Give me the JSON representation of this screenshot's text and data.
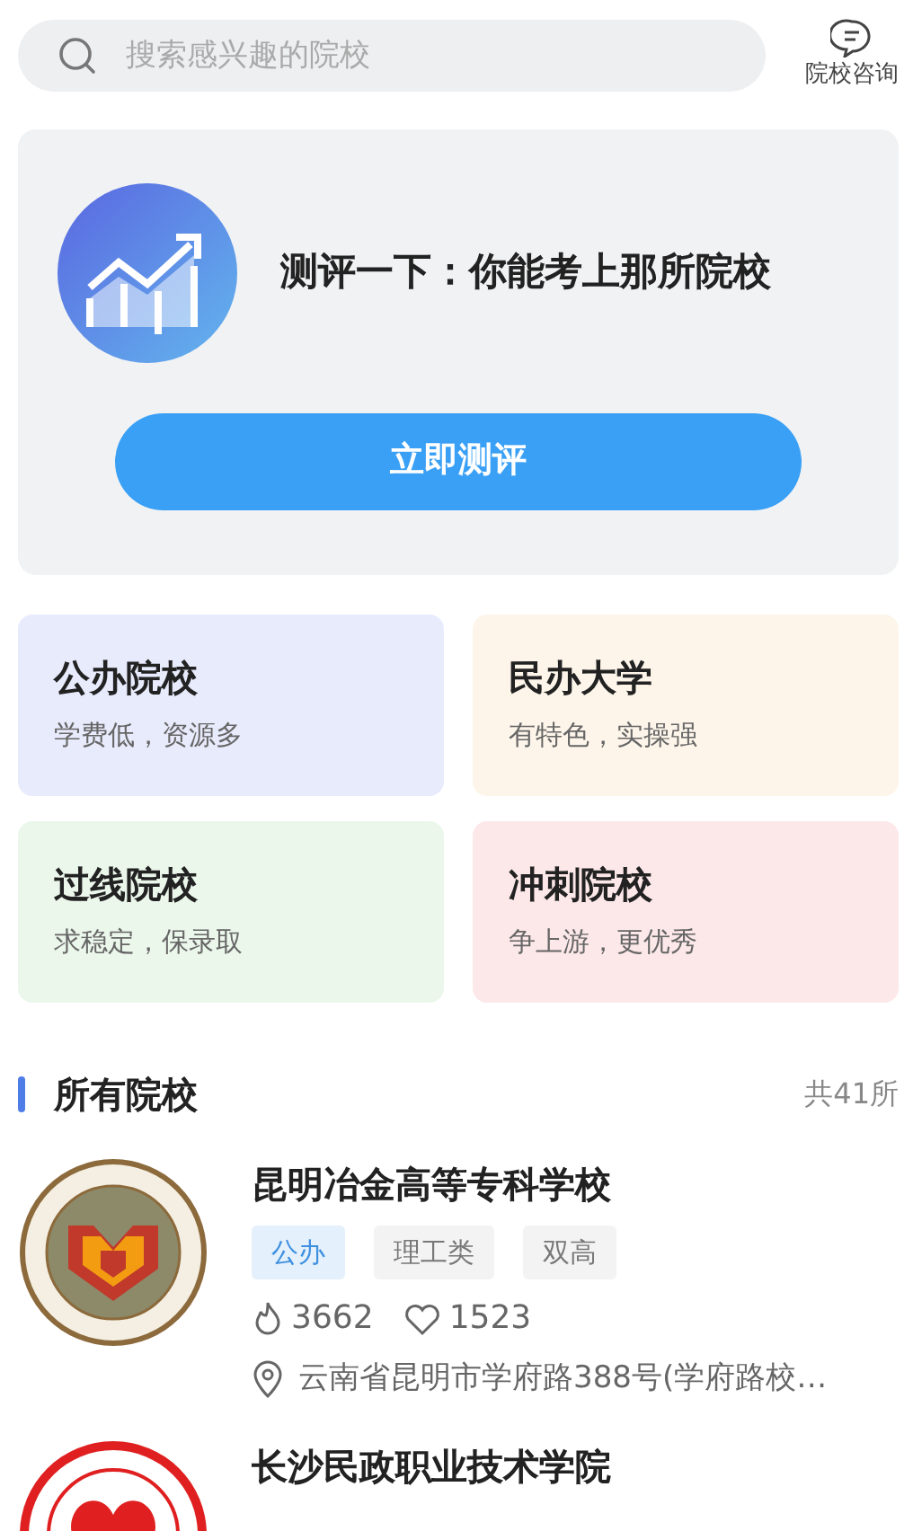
{
  "search": {
    "placeholder": "搜索感兴趣的院校"
  },
  "consult": {
    "label": "院校咨询"
  },
  "assessment": {
    "title": "测评一下：你能考上那所院校",
    "button": "立即测评"
  },
  "categories": [
    {
      "title": "公办院校",
      "subtitle": "学费低，资源多",
      "color": "#e8ebfc"
    },
    {
      "title": "民办大学",
      "subtitle": "有特色，实操强",
      "color": "#fdf5ea"
    },
    {
      "title": "过线院校",
      "subtitle": "求稳定，保录取",
      "color": "#ecf7ec"
    },
    {
      "title": "冲刺院校",
      "subtitle": "争上游，更优秀",
      "color": "#fde8e9"
    }
  ],
  "section": {
    "title": "所有院校",
    "count": "共41所"
  },
  "schools": [
    {
      "name": "昆明冶金高等专科学校",
      "tags": [
        {
          "text": "公办",
          "kind": "type"
        },
        {
          "text": "理工类",
          "kind": "plain"
        },
        {
          "text": "双高",
          "kind": "plain"
        }
      ],
      "views": "3662",
      "likes": "1523",
      "address": "云南省昆明市学府路388号(学府路校…"
    },
    {
      "name": "长沙民政职业技术学院"
    }
  ]
}
